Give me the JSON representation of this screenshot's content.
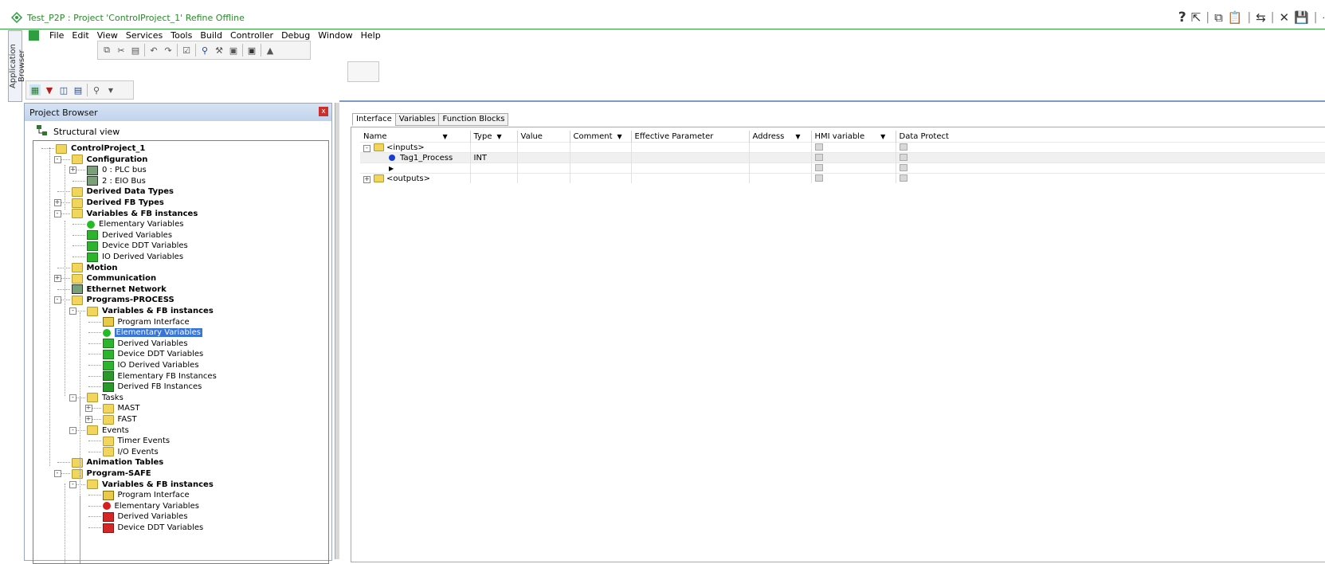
{
  "window": {
    "title": "Test_P2P : Project 'ControlProject_1' Refine Offline",
    "right_icons": [
      "help-icon",
      "pointer-icon",
      "copy-icon",
      "paste-icon",
      "connect-icon",
      "draw-icon",
      "save-icon",
      "more-icon"
    ],
    "help_glyph": "?"
  },
  "side_tab": {
    "label": "Application Browser"
  },
  "menu": {
    "items": [
      "File",
      "Edit",
      "View",
      "Services",
      "Tools",
      "Build",
      "Controller",
      "Debug",
      "Window",
      "Help"
    ]
  },
  "project_browser": {
    "title": "Project Browser",
    "close_glyph": "x",
    "structural_view": "Structural view",
    "tree": [
      {
        "label": "ControlProject_1",
        "bold": true,
        "icon": "folder-open-icon"
      },
      {
        "label": "Configuration",
        "bold": true,
        "icon": "folder-open-icon"
      },
      {
        "label": "0 : PLC bus",
        "bold": false,
        "icon": "bus-icon"
      },
      {
        "label": "2 : EIO Bus",
        "bold": false,
        "icon": "bus-icon"
      },
      {
        "label": "Derived Data Types",
        "bold": true,
        "icon": "folder-icon"
      },
      {
        "label": "Derived FB Types",
        "bold": true,
        "icon": "folder-icon"
      },
      {
        "label": "Variables & FB instances",
        "bold": true,
        "icon": "folder-open-icon"
      },
      {
        "label": "Elementary Variables",
        "bold": false,
        "icon": "green-variable-icon"
      },
      {
        "label": "Derived Variables",
        "bold": false,
        "icon": "green-derived-icon"
      },
      {
        "label": "Device DDT Variables",
        "bold": false,
        "icon": "green-derived-icon"
      },
      {
        "label": "IO Derived Variables",
        "bold": false,
        "icon": "green-io-icon"
      },
      {
        "label": "Motion",
        "bold": true,
        "icon": "folder-icon"
      },
      {
        "label": "Communication",
        "bold": true,
        "icon": "folder-icon"
      },
      {
        "label": "Ethernet Network",
        "bold": true,
        "icon": "network-icon"
      },
      {
        "label": "Programs-PROCESS",
        "bold": true,
        "icon": "folder-open-icon"
      },
      {
        "label": "Variables & FB instances",
        "bold": true,
        "icon": "folder-open-icon"
      },
      {
        "label": "Program Interface",
        "bold": false,
        "icon": "program-interface-icon"
      },
      {
        "label": "Elementary Variables",
        "bold": false,
        "icon": "green-variable-icon",
        "selected": true
      },
      {
        "label": "Derived Variables",
        "bold": false,
        "icon": "green-derived-icon"
      },
      {
        "label": "Device DDT Variables",
        "bold": false,
        "icon": "green-derived-icon"
      },
      {
        "label": "IO Derived Variables",
        "bold": false,
        "icon": "green-io-icon"
      },
      {
        "label": "Elementary FB Instances",
        "bold": false,
        "icon": "fb-instance-icon"
      },
      {
        "label": "Derived FB Instances",
        "bold": false,
        "icon": "fb-instance-icon"
      },
      {
        "label": "Tasks",
        "bold": false,
        "icon": "folder-open-icon"
      },
      {
        "label": "MAST",
        "bold": false,
        "icon": "folder-open-icon"
      },
      {
        "label": "FAST",
        "bold": false,
        "icon": "folder-icon"
      },
      {
        "label": "Events",
        "bold": false,
        "icon": "folder-open-icon"
      },
      {
        "label": "Timer Events",
        "bold": false,
        "icon": "folder-icon"
      },
      {
        "label": "I/O Events",
        "bold": false,
        "icon": "folder-icon"
      },
      {
        "label": "Animation Tables",
        "bold": true,
        "icon": "folder-icon"
      },
      {
        "label": "Program-SAFE",
        "bold": true,
        "icon": "folder-open-icon"
      },
      {
        "label": "Variables & FB instances",
        "bold": true,
        "icon": "folder-open-icon"
      },
      {
        "label": "Program Interface",
        "bold": false,
        "icon": "program-interface-icon"
      },
      {
        "label": "Elementary Variables",
        "bold": false,
        "icon": "red-variable-icon"
      },
      {
        "label": "Derived Variables",
        "bold": false,
        "icon": "red-derived-icon"
      },
      {
        "label": "Device DDT Variables",
        "bold": false,
        "icon": "red-derived-icon"
      }
    ]
  },
  "editor": {
    "tabs": [
      "Interface",
      "Variables",
      "Function Blocks"
    ],
    "active_tab": "Interface",
    "columns": [
      "Name",
      "Type",
      "Value",
      "Comment",
      "Effective Parameter",
      "Address",
      "HMI variable",
      "Data Protect"
    ],
    "rows": [
      {
        "name": "<inputs>",
        "type": "",
        "kind": "group"
      },
      {
        "name": "Tag1_Process",
        "type": "INT",
        "kind": "variable"
      },
      {
        "name": "",
        "type": "",
        "kind": "new"
      },
      {
        "name": "<outputs>",
        "type": "",
        "kind": "group"
      }
    ]
  },
  "colors": {
    "title_green": "#2a8a2a",
    "selection_blue": "#3875d7",
    "panel_header": "#c1d3ec"
  }
}
